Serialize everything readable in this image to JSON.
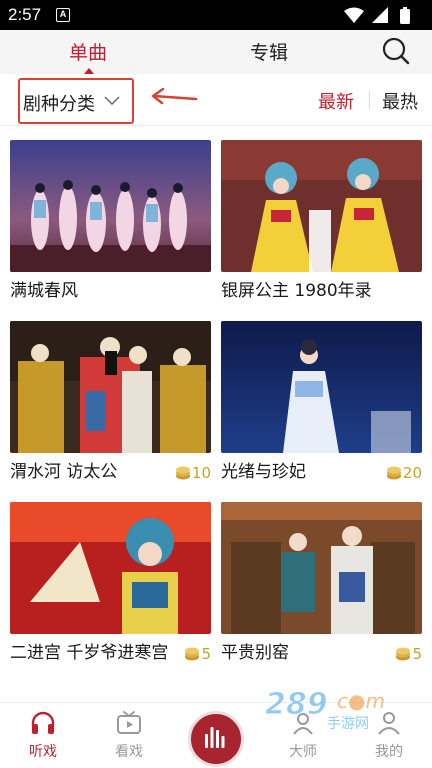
{
  "status": {
    "time": "2:57",
    "notification_glyph": "A"
  },
  "tabs": {
    "single": "单曲",
    "album": "专辑"
  },
  "filter": {
    "genre_label": "剧种分类",
    "sort_newest": "最新",
    "sort_hot": "最热"
  },
  "items": [
    {
      "title": "满城春风",
      "coins": ""
    },
    {
      "title": "银屏公主 1980年录",
      "coins": ""
    },
    {
      "title": "渭水河 访太公",
      "coins": "10"
    },
    {
      "title": "光绪与珍妃",
      "coins": "20"
    },
    {
      "title": "二进宫 千岁爷进寒宫",
      "coins": "5"
    },
    {
      "title": "平贵别窑",
      "coins": "5"
    }
  ],
  "nav": {
    "listen": "听戏",
    "watch": "看戏",
    "master": "大师",
    "mine": "我的"
  },
  "watermark": {
    "text": "289",
    "suffix": "c●m",
    "sub": "手游网"
  },
  "colors": {
    "accent": "#c01f2f",
    "annotation": "#d8432f",
    "coin": "#d9b24a",
    "play": "#a8242f"
  },
  "icons": [
    "search-icon",
    "chevron-down-icon",
    "arrow-left-icon",
    "coin-icon",
    "headphones-icon",
    "tv-icon",
    "equalizer-icon",
    "master-icon",
    "user-icon",
    "wifi-icon",
    "signal-icon",
    "battery-icon"
  ]
}
